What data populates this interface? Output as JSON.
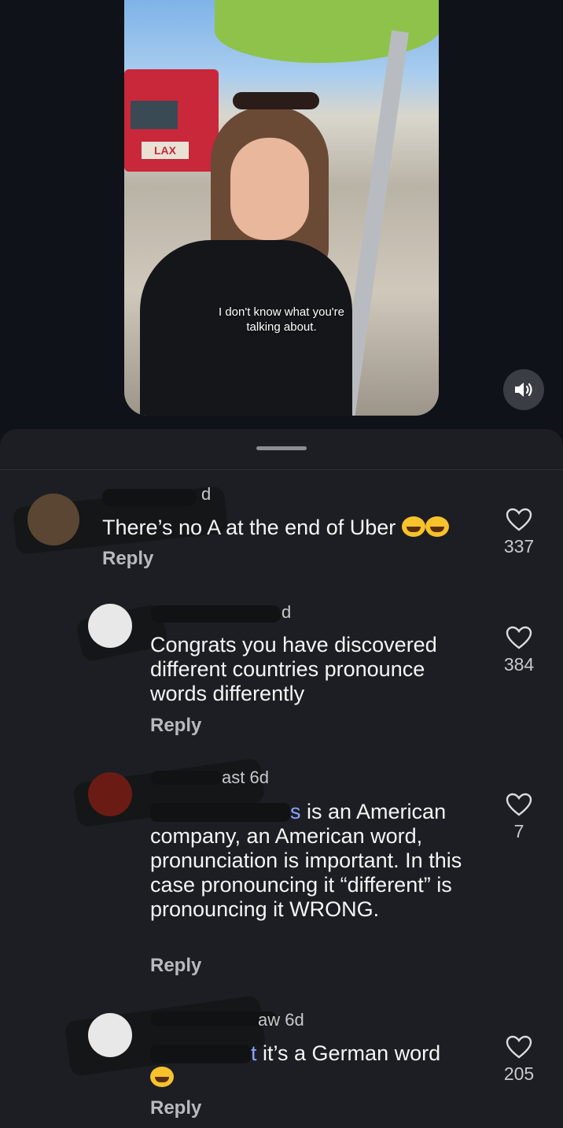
{
  "video": {
    "caption": "I don't know what you're talking about.",
    "bus_logo": "LAX",
    "sound_icon": "speaker-icon"
  },
  "comments": [
    {
      "username_visible": "d",
      "text": "There’s no A at the end of Uber",
      "reply": "Reply",
      "likes": "337"
    },
    {
      "username_visible": "d",
      "text": "Congrats you have discovered different countries pronounce words differently",
      "reply": "Reply",
      "likes": "384"
    },
    {
      "username_visible": "ast 6d",
      "mention_suffix": "s",
      "text": " is an American company, an American word, pronunciation is important. In this case pronouncing it “different” is pronouncing it WRONG.",
      "reply": "Reply",
      "likes": "7"
    },
    {
      "username_visible": "aw 6d",
      "mention_suffix": "t",
      "text": " it’s a German word",
      "reply": "Reply",
      "likes": "205"
    }
  ]
}
